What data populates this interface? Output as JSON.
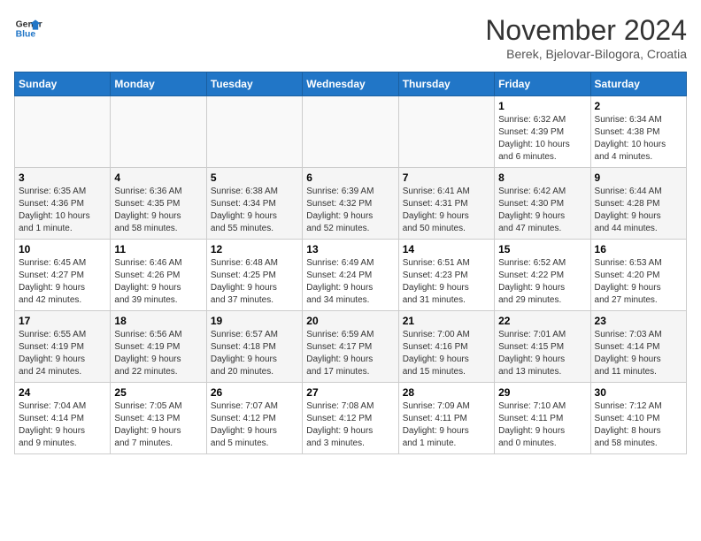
{
  "header": {
    "logo_line1": "General",
    "logo_line2": "Blue",
    "month_title": "November 2024",
    "subtitle": "Berek, Bjelovar-Bilogora, Croatia"
  },
  "weekdays": [
    "Sunday",
    "Monday",
    "Tuesday",
    "Wednesday",
    "Thursday",
    "Friday",
    "Saturday"
  ],
  "weeks": [
    [
      {
        "day": "",
        "info": ""
      },
      {
        "day": "",
        "info": ""
      },
      {
        "day": "",
        "info": ""
      },
      {
        "day": "",
        "info": ""
      },
      {
        "day": "",
        "info": ""
      },
      {
        "day": "1",
        "info": "Sunrise: 6:32 AM\nSunset: 4:39 PM\nDaylight: 10 hours\nand 6 minutes."
      },
      {
        "day": "2",
        "info": "Sunrise: 6:34 AM\nSunset: 4:38 PM\nDaylight: 10 hours\nand 4 minutes."
      }
    ],
    [
      {
        "day": "3",
        "info": "Sunrise: 6:35 AM\nSunset: 4:36 PM\nDaylight: 10 hours\nand 1 minute."
      },
      {
        "day": "4",
        "info": "Sunrise: 6:36 AM\nSunset: 4:35 PM\nDaylight: 9 hours\nand 58 minutes."
      },
      {
        "day": "5",
        "info": "Sunrise: 6:38 AM\nSunset: 4:34 PM\nDaylight: 9 hours\nand 55 minutes."
      },
      {
        "day": "6",
        "info": "Sunrise: 6:39 AM\nSunset: 4:32 PM\nDaylight: 9 hours\nand 52 minutes."
      },
      {
        "day": "7",
        "info": "Sunrise: 6:41 AM\nSunset: 4:31 PM\nDaylight: 9 hours\nand 50 minutes."
      },
      {
        "day": "8",
        "info": "Sunrise: 6:42 AM\nSunset: 4:30 PM\nDaylight: 9 hours\nand 47 minutes."
      },
      {
        "day": "9",
        "info": "Sunrise: 6:44 AM\nSunset: 4:28 PM\nDaylight: 9 hours\nand 44 minutes."
      }
    ],
    [
      {
        "day": "10",
        "info": "Sunrise: 6:45 AM\nSunset: 4:27 PM\nDaylight: 9 hours\nand 42 minutes."
      },
      {
        "day": "11",
        "info": "Sunrise: 6:46 AM\nSunset: 4:26 PM\nDaylight: 9 hours\nand 39 minutes."
      },
      {
        "day": "12",
        "info": "Sunrise: 6:48 AM\nSunset: 4:25 PM\nDaylight: 9 hours\nand 37 minutes."
      },
      {
        "day": "13",
        "info": "Sunrise: 6:49 AM\nSunset: 4:24 PM\nDaylight: 9 hours\nand 34 minutes."
      },
      {
        "day": "14",
        "info": "Sunrise: 6:51 AM\nSunset: 4:23 PM\nDaylight: 9 hours\nand 31 minutes."
      },
      {
        "day": "15",
        "info": "Sunrise: 6:52 AM\nSunset: 4:22 PM\nDaylight: 9 hours\nand 29 minutes."
      },
      {
        "day": "16",
        "info": "Sunrise: 6:53 AM\nSunset: 4:20 PM\nDaylight: 9 hours\nand 27 minutes."
      }
    ],
    [
      {
        "day": "17",
        "info": "Sunrise: 6:55 AM\nSunset: 4:19 PM\nDaylight: 9 hours\nand 24 minutes."
      },
      {
        "day": "18",
        "info": "Sunrise: 6:56 AM\nSunset: 4:19 PM\nDaylight: 9 hours\nand 22 minutes."
      },
      {
        "day": "19",
        "info": "Sunrise: 6:57 AM\nSunset: 4:18 PM\nDaylight: 9 hours\nand 20 minutes."
      },
      {
        "day": "20",
        "info": "Sunrise: 6:59 AM\nSunset: 4:17 PM\nDaylight: 9 hours\nand 17 minutes."
      },
      {
        "day": "21",
        "info": "Sunrise: 7:00 AM\nSunset: 4:16 PM\nDaylight: 9 hours\nand 15 minutes."
      },
      {
        "day": "22",
        "info": "Sunrise: 7:01 AM\nSunset: 4:15 PM\nDaylight: 9 hours\nand 13 minutes."
      },
      {
        "day": "23",
        "info": "Sunrise: 7:03 AM\nSunset: 4:14 PM\nDaylight: 9 hours\nand 11 minutes."
      }
    ],
    [
      {
        "day": "24",
        "info": "Sunrise: 7:04 AM\nSunset: 4:14 PM\nDaylight: 9 hours\nand 9 minutes."
      },
      {
        "day": "25",
        "info": "Sunrise: 7:05 AM\nSunset: 4:13 PM\nDaylight: 9 hours\nand 7 minutes."
      },
      {
        "day": "26",
        "info": "Sunrise: 7:07 AM\nSunset: 4:12 PM\nDaylight: 9 hours\nand 5 minutes."
      },
      {
        "day": "27",
        "info": "Sunrise: 7:08 AM\nSunset: 4:12 PM\nDaylight: 9 hours\nand 3 minutes."
      },
      {
        "day": "28",
        "info": "Sunrise: 7:09 AM\nSunset: 4:11 PM\nDaylight: 9 hours\nand 1 minute."
      },
      {
        "day": "29",
        "info": "Sunrise: 7:10 AM\nSunset: 4:11 PM\nDaylight: 9 hours\nand 0 minutes."
      },
      {
        "day": "30",
        "info": "Sunrise: 7:12 AM\nSunset: 4:10 PM\nDaylight: 8 hours\nand 58 minutes."
      }
    ]
  ]
}
